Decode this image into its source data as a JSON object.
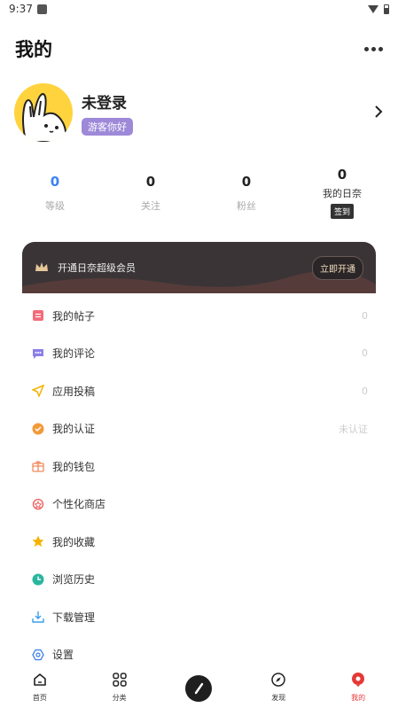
{
  "status": {
    "time": "9:37"
  },
  "header": {
    "title": "我的"
  },
  "profile": {
    "name": "未登录",
    "badge": "游客你好"
  },
  "stats": [
    {
      "value": "0",
      "label": "等级"
    },
    {
      "value": "0",
      "label": "关注"
    },
    {
      "value": "0",
      "label": "粉丝"
    },
    {
      "value": "0",
      "label": "我的日奈",
      "button": "签到"
    }
  ],
  "vip": {
    "text": "开通日奈超级会员",
    "button": "立即开通"
  },
  "menu": [
    {
      "label": "我的帖子",
      "value": "0",
      "icon": "post-icon"
    },
    {
      "label": "我的评论",
      "value": "0",
      "icon": "comment-icon"
    },
    {
      "label": "应用投稿",
      "value": "0",
      "icon": "submit-icon"
    },
    {
      "label": "我的认证",
      "value": "未认证",
      "icon": "verify-icon"
    },
    {
      "label": "我的钱包",
      "value": "",
      "icon": "wallet-icon"
    },
    {
      "label": "个性化商店",
      "value": "",
      "icon": "store-icon"
    },
    {
      "label": "我的收藏",
      "value": "",
      "icon": "star-icon"
    },
    {
      "label": "浏览历史",
      "value": "",
      "icon": "history-icon"
    },
    {
      "label": "下载管理",
      "value": "",
      "icon": "download-icon"
    },
    {
      "label": "设置",
      "value": "",
      "icon": "settings-icon"
    }
  ],
  "tabs": [
    {
      "label": "首页",
      "icon": "home-icon"
    },
    {
      "label": "分类",
      "icon": "category-icon"
    },
    {
      "label": "",
      "icon": "compose-icon"
    },
    {
      "label": "发现",
      "icon": "discover-icon"
    },
    {
      "label": "我的",
      "icon": "profile-icon",
      "active": true
    }
  ],
  "colors": {
    "accent_blue": "#3b82f6",
    "active_red": "#e53935",
    "vip_bg": "#3a3436",
    "badge_purple": "#9d89d8"
  }
}
